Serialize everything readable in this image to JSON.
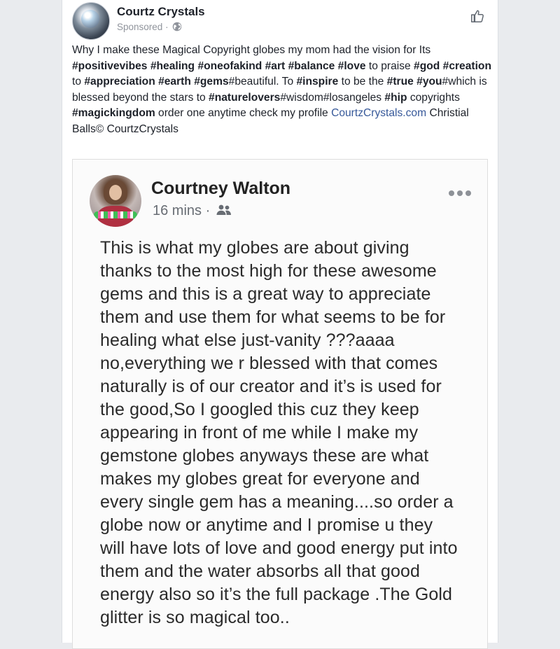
{
  "post": {
    "page_name": "Courtz Crystals",
    "sponsored_label": "Sponsored",
    "separator": "·",
    "text": {
      "p1": "Why I make these Magical Copyright globes my mom had the vision for Its ",
      "t_positivevibes": "#positivevibes",
      "t_healing": "#healing",
      "t_oneofakind": "#oneofakind",
      "t_art": "#art",
      "t_balance": "#balance",
      "t_love": "#love",
      "p2": " to praise ",
      "t_god": "#god",
      "t_creation": "#creation",
      "p3": " to ",
      "t_appreciation": "#appreciation",
      "t_earth": "#earth",
      "t_gems": "#gems",
      "p4": "#beautiful. To ",
      "t_inspire": "#inspire",
      "p5": " to be the ",
      "t_true": "#true",
      "t_you": "#you",
      "p6": "#which is blessed beyond the stars to ",
      "t_naturelovers": "#naturelovers",
      "p7": "#wisdom#losangeles ",
      "t_hip": "#hip",
      "p8": " copyrights ",
      "t_magickingdom": "#magickingdom",
      "p9": " order one anytime check my profile ",
      "link": "CourtzCrystals.com",
      "p10": " Christial Balls© CourtzCrystals"
    }
  },
  "embedded": {
    "author": "Courtney Walton",
    "time": "16 mins",
    "separator": "·",
    "lines": [
      "This is what my globes are about giving",
      "thanks to the most high for these awesome",
      "gems and this is a great way to appreciate",
      "them and use them for what seems to be for",
      "healing what else just-vanity ???aaaa",
      "no,everything we r blessed with that comes",
      "naturally is of our creator and it’s is used for",
      "the good,So I googled this cuz they keep",
      "appearing in front of me while I make my",
      "gemstone globes anyways these are what",
      "makes my globes great for everyone and",
      "every single gem has a meaning....so order a",
      "globe now or anytime and I promise u they",
      "will have lots of love and good energy put into",
      "them and the water absorbs all that good",
      "energy also so it’s the full package .The Gold",
      "glitter is so magical too.."
    ]
  },
  "icons": {
    "globe": "globe-icon",
    "like": "thumbs-up-icon",
    "friends": "friends-icon",
    "more": "more-dots-icon"
  },
  "colors": {
    "link": "#365899",
    "meta": "#90949c",
    "background": "#e9ebee"
  }
}
